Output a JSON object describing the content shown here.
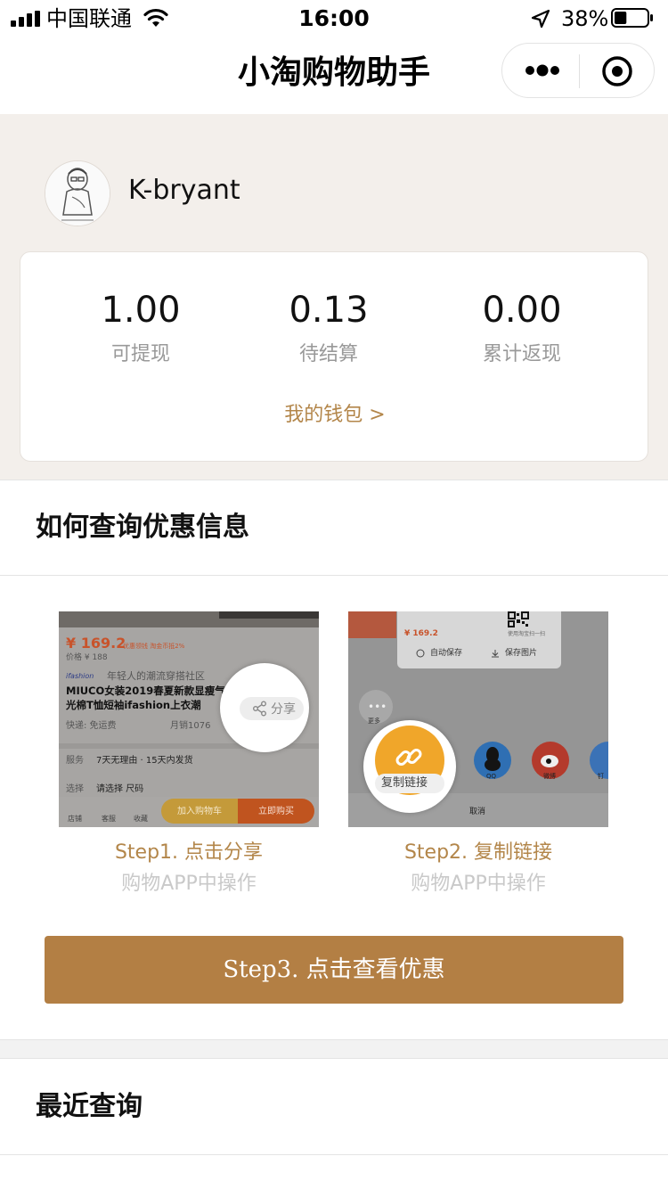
{
  "status_bar": {
    "carrier": "中国联通",
    "time": "16:00",
    "battery_percent": "38%",
    "battery_level": 0.38,
    "icons": [
      "signal-icon",
      "wifi-icon",
      "location-icon",
      "battery-icon"
    ]
  },
  "nav": {
    "title": "小淘购物助手",
    "more_icon": "more-dots-icon",
    "close_icon": "target-circle-icon"
  },
  "profile": {
    "username": "K-bryant"
  },
  "stats": [
    {
      "value": "1.00",
      "label": "可提现"
    },
    {
      "value": "0.13",
      "label": "待结算"
    },
    {
      "value": "0.00",
      "label": "累计返现"
    }
  ],
  "wallet_link": "我的钱包 >",
  "how_to": {
    "title": "如何查询优惠信息",
    "step1": {
      "caption": "Step1. 点击分享",
      "sub": "购物APP中操作",
      "mock": {
        "price": "¥ 169.2",
        "price_tags": "优惠领钱  淘金币抵2%",
        "original_price": "价格 ¥ 188",
        "brand": "ifashion",
        "brand_slogan": "年轻人的潮流穿搭社区",
        "product_line1": "MIUCO女装2019春夏新款显瘦气",
        "product_line2": "光棉T恤短袖ifashion上衣潮",
        "shipping": "快递: 免运费",
        "sales": "月销1076",
        "service_label": "服务",
        "service_text": "7天无理由 · 15天内发货",
        "select_label": "选择",
        "select_text": "请选择 尺码",
        "tab_shop": "店铺",
        "tab_service": "客服",
        "tab_fav": "收藏",
        "add_cart": "加入购物车",
        "buy_now": "立即购买",
        "share": "分享"
      }
    },
    "step2": {
      "caption": "Step2. 复制链接",
      "sub": "购物APP中操作",
      "mock": {
        "price": "¥ 169.2",
        "qr_hint": "使用淘宝扫一扫",
        "auto_save": "自动保存",
        "save_image": "保存图片",
        "more": "更多",
        "copy_link": "复制链接",
        "qq": "QQ",
        "weibo": "微博",
        "ding": "钉",
        "cancel": "取消"
      }
    },
    "step3_button": "Step3. 点击查看优惠"
  },
  "recent": {
    "title": "最近查询"
  },
  "colors": {
    "accent": "#b3864a",
    "button": "#b37f44",
    "profile_bg": "#f3efeb"
  }
}
